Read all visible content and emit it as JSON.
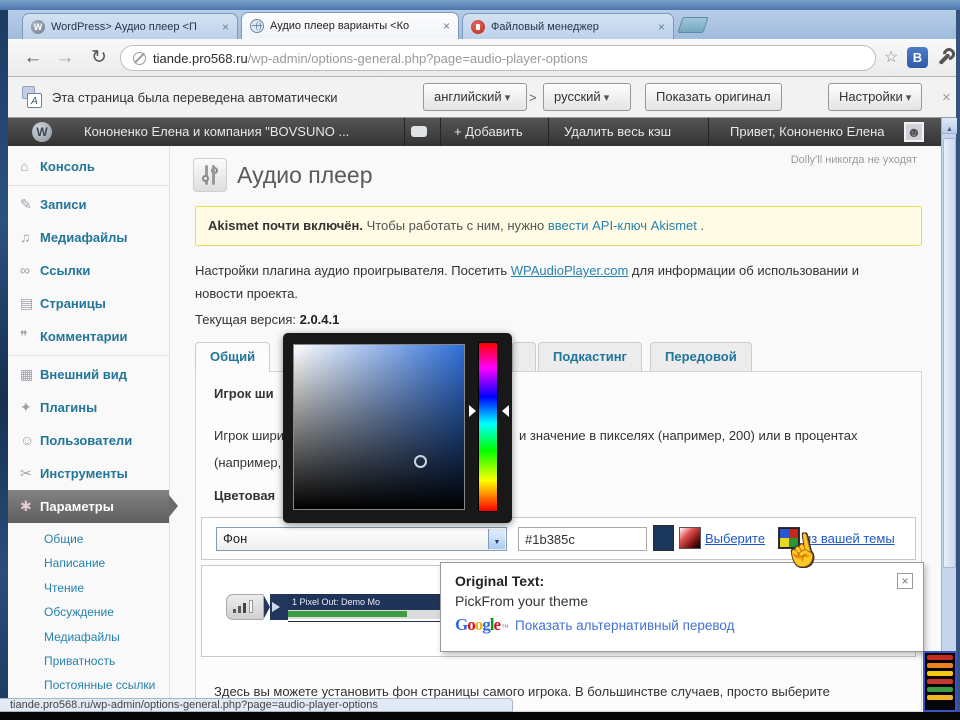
{
  "browser": {
    "tabs": [
      {
        "label": "WordPress> Аудио плеер <П"
      },
      {
        "label": "Аудио плеер варианты <Ко"
      },
      {
        "label": "Файловый менеджер"
      }
    ],
    "url_domain": "tiande.pro568.ru",
    "url_path": "/wp-admin/options-general.php?page=audio-player-options",
    "vk_badge": "B"
  },
  "translate_bar": {
    "message": "Эта страница была переведена автоматически",
    "source_lang": "английский",
    "separator": ">",
    "target_lang": "русский",
    "show_original": "Показать оригинал",
    "settings": "Настройки"
  },
  "admin_bar": {
    "site_name": "Кононенко Елена и компания \"BOVSUNO ...",
    "add_new": "+ Добавить",
    "clear_cache": "Удалить весь кэш",
    "greeting": "Привет, Кононенко Елена"
  },
  "sidebar": {
    "items": [
      {
        "label": "Консоль"
      },
      {
        "label": "Записи"
      },
      {
        "label": "Медиафайлы"
      },
      {
        "label": "Ссылки"
      },
      {
        "label": "Страницы"
      },
      {
        "label": "Комментарии"
      },
      {
        "label": "Внешний вид"
      },
      {
        "label": "Плагины"
      },
      {
        "label": "Пользователи"
      },
      {
        "label": "Инструменты"
      },
      {
        "label": "Параметры"
      }
    ],
    "subitems": [
      "Общие",
      "Написание",
      "Чтение",
      "Обсуждение",
      "Медиафайлы",
      "Приватность",
      "Постоянные ссылки"
    ]
  },
  "page": {
    "title": "Аудио плеер",
    "dolly": "Dolly'll никогда не уходят",
    "notice": {
      "bold": "Akismet почти включён.",
      "middle": " Чтобы работать с ним, нужно ",
      "link": "ввести API-ключ Akismet",
      "tail": " ."
    },
    "intro": {
      "before": "Настройки плагина аудио проигрывателя. Посетить ",
      "link": "WPAudioPlayer.com",
      "after": " для информации об использовании и новости проекта."
    },
    "version_label": "Текущая версия: ",
    "version": "2.0.4.1",
    "tabs": [
      "Общий",
      "Подкастинг",
      "Передовой"
    ],
    "panel": {
      "heading1": "Игрок ши",
      "p1_left": "Игрок шири",
      "p1_right": "и значение в пикселях (например, 200) или в процентах",
      "p1_line2": "(например,",
      "heading2": "Цветовая"
    },
    "form": {
      "select_value": "Фон",
      "color_value": "#1b385c",
      "choose_link": "Выберите",
      "theme_link": "из вашей темы"
    },
    "player": {
      "track_title": "1 Pixel Out: Demo Mo"
    },
    "tooltip": {
      "heading": "Original Text:",
      "original": "PickFrom your theme",
      "google": [
        "G",
        "o",
        "o",
        "g",
        "l",
        "e"
      ],
      "tm": "™",
      "alt_link": "Показать альтернативный перевод"
    },
    "bottom_text": "Здесь вы можете установить фон страницы самого игрока. В большинстве случаев, просто выберите"
  },
  "status_bar": {
    "url": "tiande.pro568.ru/wp-admin/options-general.php?page=audio-player-options"
  },
  "colors": {
    "selected_color": "#1b385c",
    "picker_hue": "#2e6fd9",
    "wp_link": "#21759b",
    "notice_bg": "#fffbe4",
    "notice_border": "#e6db55"
  }
}
